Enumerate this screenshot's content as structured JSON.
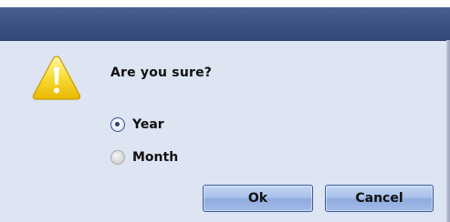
{
  "dialog": {
    "message": "Are you sure?",
    "icon": "warning-icon",
    "options": [
      {
        "label": "Year",
        "selected": true
      },
      {
        "label": "Month",
        "selected": false
      }
    ],
    "buttons": {
      "ok_label": "Ok",
      "cancel_label": "Cancel"
    }
  },
  "colors": {
    "titlebar": "#3e5283",
    "dialog_background": "#dde4f2",
    "warning_yellow": "#f7d21c",
    "button_blue": "#a9c1ea"
  }
}
